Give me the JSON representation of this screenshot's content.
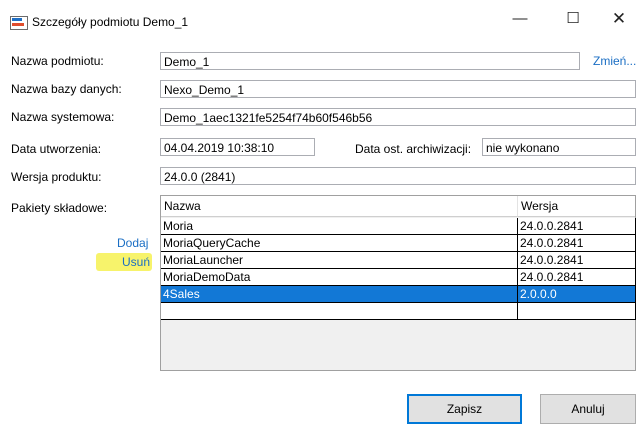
{
  "window": {
    "title": "Szczegóły podmiotu Demo_1",
    "minimize_glyph": "—",
    "maximize_glyph": "☐",
    "close_glyph": "✕"
  },
  "form": {
    "entity_name_label": "Nazwa podmiotu:",
    "entity_name_value": "Demo_1",
    "change_link": "Zmień...",
    "db_name_label": "Nazwa bazy danych:",
    "db_name_value": "Nexo_Demo_1",
    "system_name_label": "Nazwa systemowa:",
    "system_name_value": "Demo_1aec1321fe5254f74b60f546b56",
    "created_label": "Data utworzenia:",
    "created_value": "04.04.2019 10:38:10",
    "archive_label": "Data ost. archiwizacji:",
    "archive_value": "nie wykonano",
    "version_label": "Wersja produktu:",
    "version_value": "24.0.0 (2841)",
    "packages_label": "Pakiety składowe:",
    "add_link": "Dodaj",
    "remove_link": "Usuń"
  },
  "packages": {
    "columns": [
      "Nazwa",
      "Wersja"
    ],
    "rows": [
      {
        "name": "Moria",
        "version": "24.0.0.2841"
      },
      {
        "name": "MoriaQueryCache",
        "version": "24.0.0.2841"
      },
      {
        "name": "MoriaLauncher",
        "version": "24.0.0.2841"
      },
      {
        "name": "MoriaDemoData",
        "version": "24.0.0.2841"
      },
      {
        "name": "4Sales",
        "version": "2.0.0.0"
      },
      {
        "name": "",
        "version": ""
      }
    ]
  },
  "buttons": {
    "save": "Zapisz",
    "cancel": "Anuluj"
  },
  "colors": {
    "selection": "#1278d6",
    "link": "#1a6ec4",
    "highlight": "#f7f36b"
  }
}
